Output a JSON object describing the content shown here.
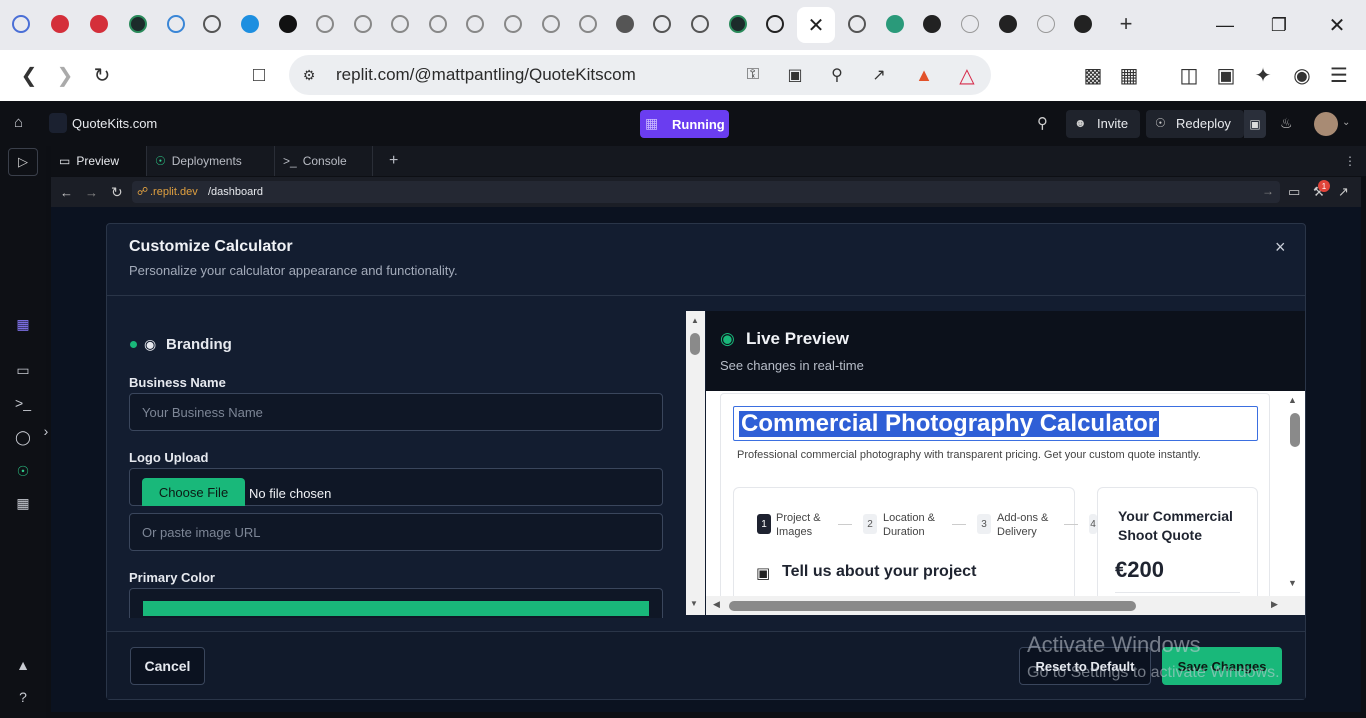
{
  "browser": {
    "url": "replit.com/@mattpantling/QuoteKitscom",
    "active_tab_close": "✕",
    "new_tab": "+"
  },
  "replit": {
    "project_name": "QuoteKits.com",
    "status": "Running",
    "invite_label": "Invite",
    "redeploy_label": "Redeploy",
    "tabs": [
      "Preview",
      "Deployments",
      "Console"
    ],
    "add_tab": "+",
    "webview_url_host": ".replit.dev",
    "webview_url_path": "/dashboard",
    "badge_count": "1"
  },
  "modal": {
    "title": "Customize Calculator",
    "subtitle": "Personalize your calculator appearance and functionality.",
    "close": "×",
    "section_branding": "Branding",
    "business_name_label": "Business Name",
    "business_name_placeholder": "Your Business Name",
    "logo_upload_label": "Logo Upload",
    "choose_file_label": "Choose File",
    "no_file_text": "No file chosen",
    "logo_url_placeholder": "Or paste image URL",
    "primary_color_label": "Primary Color",
    "primary_color": "#19b87a",
    "cancel_label": "Cancel",
    "reset_label": "Reset to Default",
    "save_label": "Save Changes"
  },
  "preview": {
    "title": "Live Preview",
    "subtitle": "See changes in real-time",
    "calc_title": "Commercial Photography Calculator",
    "calc_desc": "Professional commercial photography with transparent pricing. Get your custom quote instantly.",
    "steps": [
      {
        "num": "1",
        "label": "Project & Images"
      },
      {
        "num": "2",
        "label": "Location & Duration"
      },
      {
        "num": "3",
        "label": "Add-ons & Delivery"
      },
      {
        "num": "4",
        "label": ""
      }
    ],
    "section_heading": "Tell us about your project",
    "quote_title": "Your Commercial Shoot Quote",
    "quote_price": "€200"
  },
  "watermark": {
    "line1": "Activate Windows",
    "line2": "Go to Settings to activate Windows."
  },
  "colors": {
    "accent_green": "#19b87a",
    "running_purple": "#6a3df0",
    "selection_blue": "#2f5fd6"
  }
}
